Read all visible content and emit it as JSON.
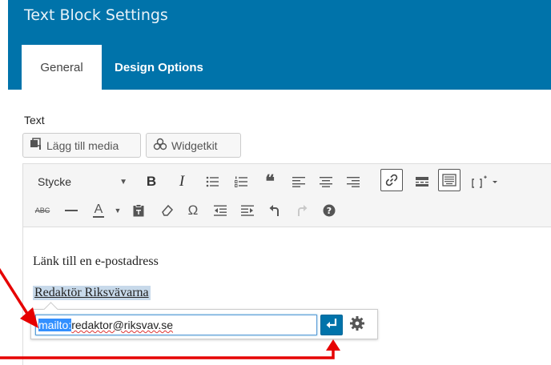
{
  "dialog": {
    "title": "Text Block Settings"
  },
  "tabs": [
    {
      "label": "General",
      "active": true
    },
    {
      "label": "Design Options",
      "active": false
    }
  ],
  "field": {
    "label": "Text"
  },
  "media_buttons": [
    {
      "label": "Lägg till media",
      "icon": "add-media-icon"
    },
    {
      "label": "Widgetkit",
      "icon": "widgetkit-icon"
    }
  ],
  "toolbar": {
    "format_value": "Stycke",
    "row1_icons": [
      "bold-icon",
      "italic-icon",
      "bulleted-list-icon",
      "numbered-list-icon",
      "blockquote-icon",
      "align-left-icon",
      "align-center-icon",
      "align-right-icon",
      "link-icon",
      "read-more-icon",
      "toolbar-toggle-icon",
      "shortcode-icon"
    ],
    "row2_icons": [
      "strikethrough-icon",
      "horizontal-line-icon",
      "text-color-icon",
      "paste-as-text-icon",
      "clear-formatting-icon",
      "special-character-icon",
      "decrease-indent-icon",
      "increase-indent-icon",
      "undo-icon",
      "redo-icon",
      "help-icon"
    ],
    "bold_glyph": "B",
    "italic_glyph": "I",
    "strike_glyph": "ABC",
    "text_color_glyph": "A",
    "omega_glyph": "Ω"
  },
  "content": {
    "paragraph": "Länk till en e-postadress",
    "link_text": "Redaktör Riksvävarna"
  },
  "link_popup": {
    "url_selected": "mailto:",
    "url_rest": "redaktor@riksvav.se"
  },
  "colors": {
    "header_bg": "#0073aa",
    "selection": "#3390ff",
    "link_highlight": "#c7d9ea",
    "annotation_arrow": "#e60000"
  }
}
